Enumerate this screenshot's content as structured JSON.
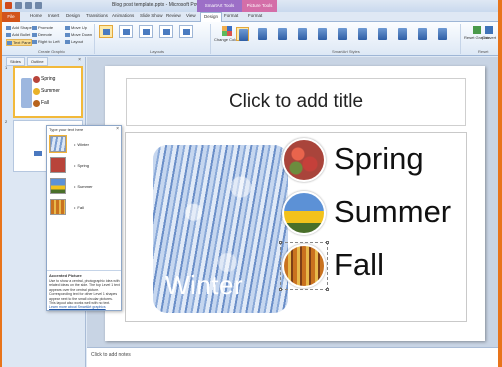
{
  "window": {
    "title": "Blog post template.pptx - Microsoft PowerPoint",
    "context_tabs": {
      "smartart": "SmartArt Tools",
      "drawing": "Picture Tools"
    }
  },
  "tabs": [
    "File",
    "Home",
    "Insert",
    "Design",
    "Transitions",
    "Animations",
    "Slide Show",
    "Review",
    "View",
    "Design",
    "Format",
    "Format"
  ],
  "ribbon": {
    "create_graphic": {
      "items": [
        "Add Shape",
        "Add Bullet",
        "Text Pane",
        "Promote",
        "Demote",
        "Right to Left",
        "Move Up",
        "Move Down",
        "Layout"
      ],
      "label": "Create Graphic"
    },
    "layouts_label": "Layouts",
    "change_colors": "Change Colors",
    "styles_label": "SmartArt Styles",
    "reset_graphic": "Reset Graphic",
    "convert": "Convert",
    "reset_label": "Reset"
  },
  "pane": {
    "tabs": [
      "Slides",
      "Outline"
    ],
    "close": "×",
    "thumbs": [
      {
        "num": "1",
        "labels": [
          "Spring",
          "Summer",
          "Fall"
        ]
      },
      {
        "num": "2"
      }
    ]
  },
  "slide": {
    "title_placeholder": "Click to add title",
    "winter": "Winter",
    "seasons": [
      "Spring",
      "Summer",
      "Fall"
    ]
  },
  "text_pane": {
    "header": "Type your text here",
    "close": "×",
    "items": [
      "Winter",
      "Spring",
      "Summer",
      "Fall"
    ],
    "info_title": "Accented Picture",
    "info_body": "Use to show a central, photographic idea with related ideas on the side. The top Level 1 text appears over the central picture. Corresponding text for other Level 1 shapes appear next to the small circular pictures. This layout also works well with no text.",
    "info_link": "Learn more about SmartArt graphics"
  },
  "notes": {
    "placeholder": "Click to add notes"
  },
  "colors": {
    "frame": "#e8741a",
    "file_tab": "#d2541b",
    "smartart_ctx": "#9c6fc7",
    "picture_ctx": "#d46ea8",
    "selection": "#f2b93b"
  }
}
